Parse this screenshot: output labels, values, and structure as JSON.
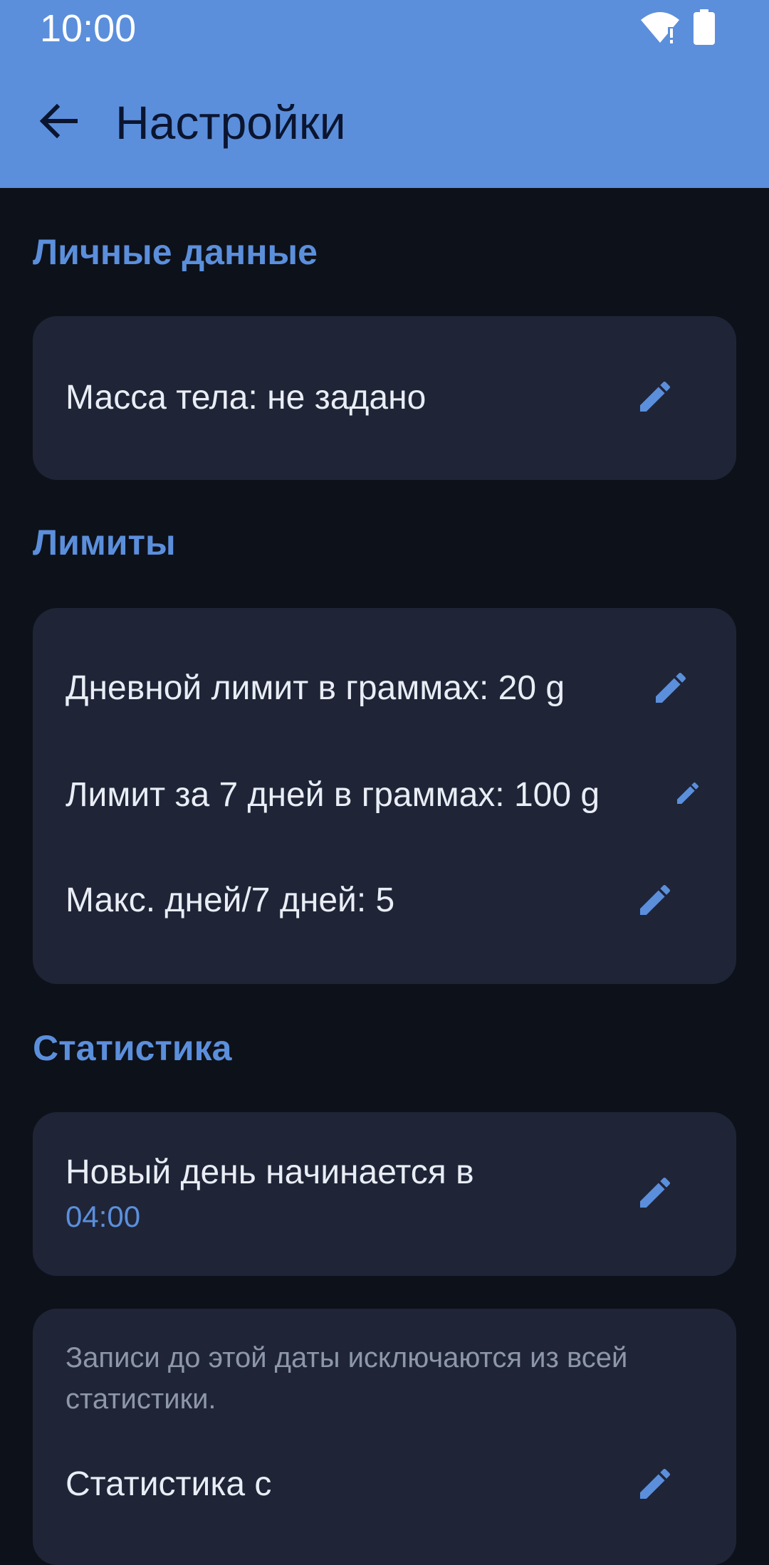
{
  "status_bar": {
    "time": "10:00",
    "icons": [
      "wifi-icon",
      "battery-icon"
    ]
  },
  "appbar": {
    "title": "Настройки",
    "back_icon": "arrow-back-icon"
  },
  "colors": {
    "accent": "#5b8fdc",
    "background": "#0d111a",
    "card": "#1f2537",
    "text": "#e9edf5",
    "muted": "#8e97aa"
  },
  "sections": {
    "personal": {
      "header": "Личные данные",
      "body_mass": "Масса тела: не задано"
    },
    "limits": {
      "header": "Лимиты",
      "daily_limit": "Дневной лимит в граммах: 20 g",
      "weekly_limit": "Лимит за 7 дней в граммах: 100 g",
      "max_days": "Макс. дней/7 дней: 5"
    },
    "statistics": {
      "header": "Статистика",
      "new_day_label": "Новый день начинается в",
      "new_day_value": "04:00",
      "exclude_note": "Записи до этой даты исключаются из всей статистики.",
      "stats_from_label": "Статистика с"
    }
  },
  "edit_icon": "pencil-icon"
}
